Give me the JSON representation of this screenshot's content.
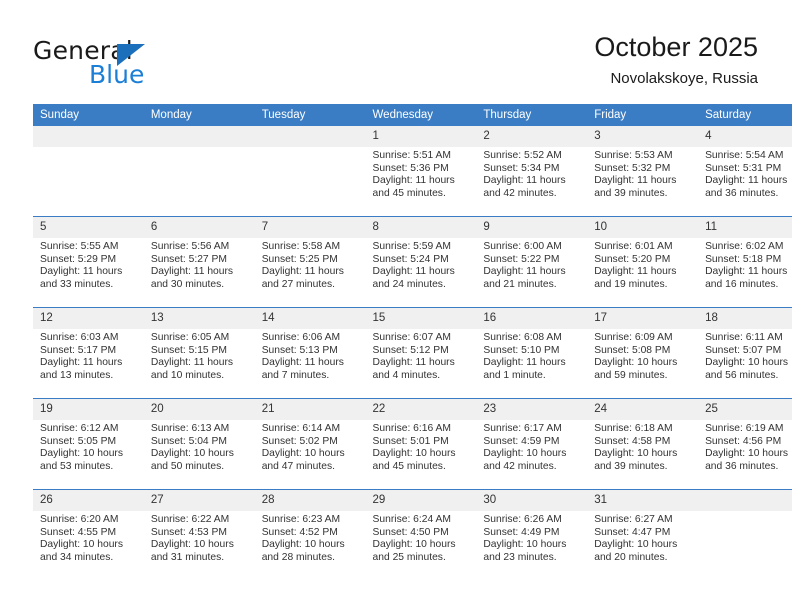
{
  "logo": {
    "word_top": "General",
    "word_bottom": "Blue",
    "triangle_color": "#1c6fba",
    "blue_text_color": "#1c7fd6"
  },
  "header": {
    "title": "October 2025",
    "subtitle": "Novolakskoye, Russia"
  },
  "theme": {
    "header_row_bg": "#3b7dc4",
    "header_row_text": "#ffffff",
    "daynum_bg": "#f0f0f0",
    "row_divider": "#3b7dc4",
    "body_text": "#333333"
  },
  "calendar": {
    "weekday_headers": [
      "Sunday",
      "Monday",
      "Tuesday",
      "Wednesday",
      "Thursday",
      "Friday",
      "Saturday"
    ],
    "labels": {
      "sunrise": "Sunrise:",
      "sunset": "Sunset:",
      "daylight": "Daylight:"
    },
    "weeks": [
      [
        {
          "day": "",
          "empty": true
        },
        {
          "day": "",
          "empty": true
        },
        {
          "day": "",
          "empty": true
        },
        {
          "day": "1",
          "sunrise": "Sunrise: 5:51 AM",
          "sunset": "Sunset: 5:36 PM",
          "daylight": "Daylight: 11 hours and 45 minutes."
        },
        {
          "day": "2",
          "sunrise": "Sunrise: 5:52 AM",
          "sunset": "Sunset: 5:34 PM",
          "daylight": "Daylight: 11 hours and 42 minutes."
        },
        {
          "day": "3",
          "sunrise": "Sunrise: 5:53 AM",
          "sunset": "Sunset: 5:32 PM",
          "daylight": "Daylight: 11 hours and 39 minutes."
        },
        {
          "day": "4",
          "sunrise": "Sunrise: 5:54 AM",
          "sunset": "Sunset: 5:31 PM",
          "daylight": "Daylight: 11 hours and 36 minutes."
        }
      ],
      [
        {
          "day": "5",
          "sunrise": "Sunrise: 5:55 AM",
          "sunset": "Sunset: 5:29 PM",
          "daylight": "Daylight: 11 hours and 33 minutes."
        },
        {
          "day": "6",
          "sunrise": "Sunrise: 5:56 AM",
          "sunset": "Sunset: 5:27 PM",
          "daylight": "Daylight: 11 hours and 30 minutes."
        },
        {
          "day": "7",
          "sunrise": "Sunrise: 5:58 AM",
          "sunset": "Sunset: 5:25 PM",
          "daylight": "Daylight: 11 hours and 27 minutes."
        },
        {
          "day": "8",
          "sunrise": "Sunrise: 5:59 AM",
          "sunset": "Sunset: 5:24 PM",
          "daylight": "Daylight: 11 hours and 24 minutes."
        },
        {
          "day": "9",
          "sunrise": "Sunrise: 6:00 AM",
          "sunset": "Sunset: 5:22 PM",
          "daylight": "Daylight: 11 hours and 21 minutes."
        },
        {
          "day": "10",
          "sunrise": "Sunrise: 6:01 AM",
          "sunset": "Sunset: 5:20 PM",
          "daylight": "Daylight: 11 hours and 19 minutes."
        },
        {
          "day": "11",
          "sunrise": "Sunrise: 6:02 AM",
          "sunset": "Sunset: 5:18 PM",
          "daylight": "Daylight: 11 hours and 16 minutes."
        }
      ],
      [
        {
          "day": "12",
          "sunrise": "Sunrise: 6:03 AM",
          "sunset": "Sunset: 5:17 PM",
          "daylight": "Daylight: 11 hours and 13 minutes."
        },
        {
          "day": "13",
          "sunrise": "Sunrise: 6:05 AM",
          "sunset": "Sunset: 5:15 PM",
          "daylight": "Daylight: 11 hours and 10 minutes."
        },
        {
          "day": "14",
          "sunrise": "Sunrise: 6:06 AM",
          "sunset": "Sunset: 5:13 PM",
          "daylight": "Daylight: 11 hours and 7 minutes."
        },
        {
          "day": "15",
          "sunrise": "Sunrise: 6:07 AM",
          "sunset": "Sunset: 5:12 PM",
          "daylight": "Daylight: 11 hours and 4 minutes."
        },
        {
          "day": "16",
          "sunrise": "Sunrise: 6:08 AM",
          "sunset": "Sunset: 5:10 PM",
          "daylight": "Daylight: 11 hours and 1 minute."
        },
        {
          "day": "17",
          "sunrise": "Sunrise: 6:09 AM",
          "sunset": "Sunset: 5:08 PM",
          "daylight": "Daylight: 10 hours and 59 minutes."
        },
        {
          "day": "18",
          "sunrise": "Sunrise: 6:11 AM",
          "sunset": "Sunset: 5:07 PM",
          "daylight": "Daylight: 10 hours and 56 minutes."
        }
      ],
      [
        {
          "day": "19",
          "sunrise": "Sunrise: 6:12 AM",
          "sunset": "Sunset: 5:05 PM",
          "daylight": "Daylight: 10 hours and 53 minutes."
        },
        {
          "day": "20",
          "sunrise": "Sunrise: 6:13 AM",
          "sunset": "Sunset: 5:04 PM",
          "daylight": "Daylight: 10 hours and 50 minutes."
        },
        {
          "day": "21",
          "sunrise": "Sunrise: 6:14 AM",
          "sunset": "Sunset: 5:02 PM",
          "daylight": "Daylight: 10 hours and 47 minutes."
        },
        {
          "day": "22",
          "sunrise": "Sunrise: 6:16 AM",
          "sunset": "Sunset: 5:01 PM",
          "daylight": "Daylight: 10 hours and 45 minutes."
        },
        {
          "day": "23",
          "sunrise": "Sunrise: 6:17 AM",
          "sunset": "Sunset: 4:59 PM",
          "daylight": "Daylight: 10 hours and 42 minutes."
        },
        {
          "day": "24",
          "sunrise": "Sunrise: 6:18 AM",
          "sunset": "Sunset: 4:58 PM",
          "daylight": "Daylight: 10 hours and 39 minutes."
        },
        {
          "day": "25",
          "sunrise": "Sunrise: 6:19 AM",
          "sunset": "Sunset: 4:56 PM",
          "daylight": "Daylight: 10 hours and 36 minutes."
        }
      ],
      [
        {
          "day": "26",
          "sunrise": "Sunrise: 6:20 AM",
          "sunset": "Sunset: 4:55 PM",
          "daylight": "Daylight: 10 hours and 34 minutes."
        },
        {
          "day": "27",
          "sunrise": "Sunrise: 6:22 AM",
          "sunset": "Sunset: 4:53 PM",
          "daylight": "Daylight: 10 hours and 31 minutes."
        },
        {
          "day": "28",
          "sunrise": "Sunrise: 6:23 AM",
          "sunset": "Sunset: 4:52 PM",
          "daylight": "Daylight: 10 hours and 28 minutes."
        },
        {
          "day": "29",
          "sunrise": "Sunrise: 6:24 AM",
          "sunset": "Sunset: 4:50 PM",
          "daylight": "Daylight: 10 hours and 25 minutes."
        },
        {
          "day": "30",
          "sunrise": "Sunrise: 6:26 AM",
          "sunset": "Sunset: 4:49 PM",
          "daylight": "Daylight: 10 hours and 23 minutes."
        },
        {
          "day": "31",
          "sunrise": "Sunrise: 6:27 AM",
          "sunset": "Sunset: 4:47 PM",
          "daylight": "Daylight: 10 hours and 20 minutes."
        },
        {
          "day": "",
          "empty": true
        }
      ]
    ]
  }
}
